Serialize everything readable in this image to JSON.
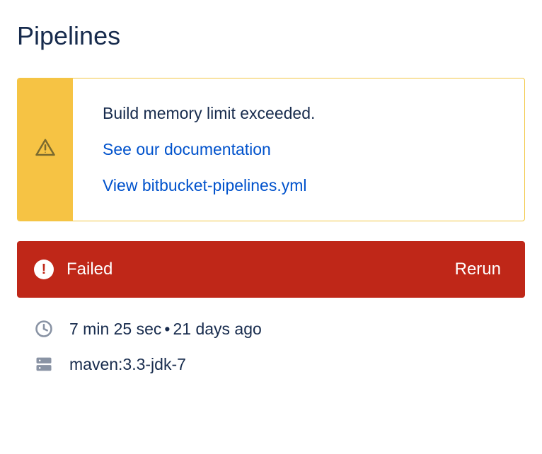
{
  "page": {
    "title": "Pipelines"
  },
  "warning": {
    "message": "Build memory limit exceeded.",
    "doc_link_label": "See our documentation",
    "yml_link_label": "View bitbucket-pipelines.yml"
  },
  "status": {
    "label": "Failed",
    "rerun_label": "Rerun",
    "color": "#bf2718"
  },
  "meta": {
    "duration": "7 min 25 sec",
    "separator": "•",
    "when": "21 days ago",
    "image": "maven:3.3-jdk-7"
  }
}
